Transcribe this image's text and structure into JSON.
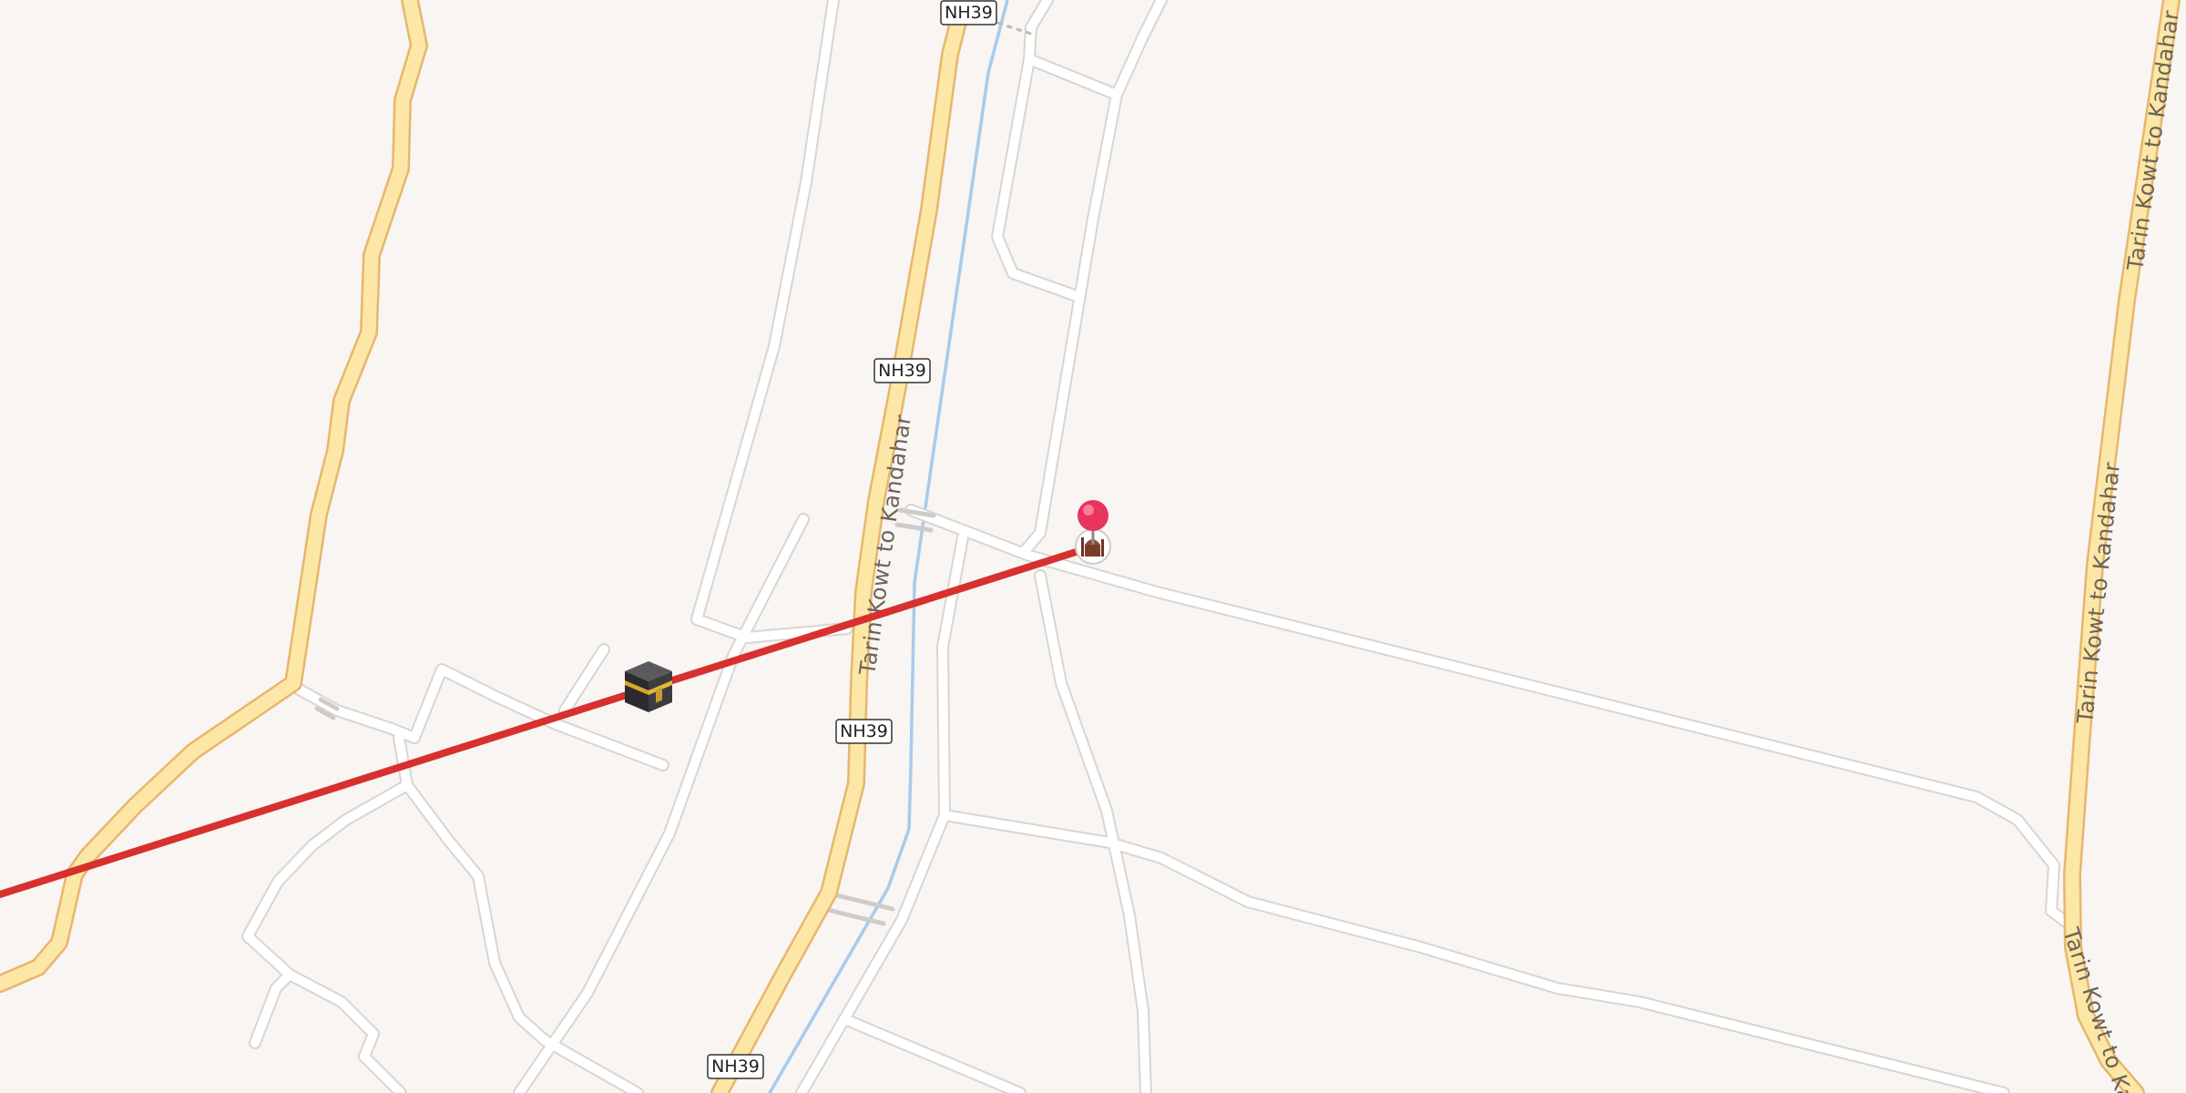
{
  "map": {
    "route_shields": [
      "NH39",
      "NH39",
      "NH39",
      "NH39"
    ],
    "road_labels": [
      "Tarin Kowt to Kandahar",
      "Tarin Kowt to Kandahar",
      "Tarin Kowt to Kandahar",
      "Tarin Kowt to Ka"
    ],
    "colors": {
      "background": "#f8f5f2",
      "primary_road": "#fde7a6",
      "minor_road": "#ffffff",
      "canal": "#a6cbee",
      "qibla_line": "#d7302f",
      "location_pin": "#e8345f"
    },
    "icons": [
      "kaaba-icon",
      "location-pin-icon",
      "mosque-icon"
    ]
  }
}
